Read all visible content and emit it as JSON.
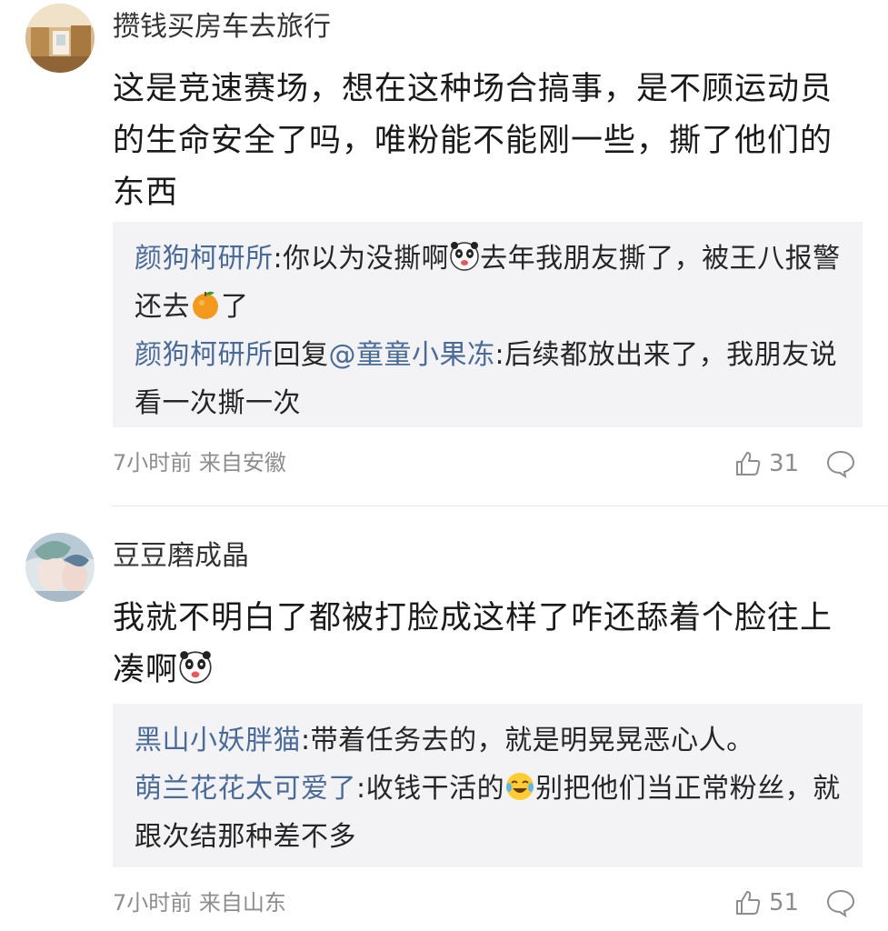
{
  "comments": [
    {
      "username": "攒钱买房车去旅行",
      "text": "这是竞速赛场，想在这种场合搞事，是不顾运动员的生命安全了吗，唯粉能不能刚一些，撕了他们的东西",
      "replies": [
        {
          "name": "颜狗柯研所",
          "sep": ":",
          "pre": "你以为没撕啊",
          "emoji1": "panda-emoji",
          "mid": "去年我朋友撕了，被王八报警还去",
          "emoji2": "orange-emoji",
          "post": "了"
        },
        {
          "name": "颜狗柯研所",
          "action": "回复",
          "mention": "@童童小果冻",
          "sep": ":",
          "text": "后续都放出来了，我朋友说看一次撕一次"
        }
      ],
      "time": "7小时前",
      "location": "来自安徽",
      "likes": "31",
      "avatar_icon": "room-photo-avatar"
    },
    {
      "username": "豆豆磨成晶",
      "text": "我就不明白了都被打脸成这样了咋还舔着个脸往上凑啊",
      "text_emoji": "panda-emoji",
      "replies": [
        {
          "name": "黑山小妖胖猫",
          "sep": ":",
          "text": "带着任务去的，就是明晃晃恶心人。"
        },
        {
          "name": "萌兰花花太可爱了",
          "sep": ":",
          "pre": "收钱干活的",
          "emoji1": "laugh-cry-emoji",
          "post": "别把他们当正常粉丝，就跟次结那种差不多"
        }
      ],
      "time": "7小时前",
      "location": "来自山东",
      "likes": "51",
      "avatar_icon": "anime-illustration-avatar"
    }
  ],
  "colors": {
    "reply_name": "#4a6b98",
    "meta": "#8d8d8d",
    "reply_bg": "#f3f3f5"
  }
}
